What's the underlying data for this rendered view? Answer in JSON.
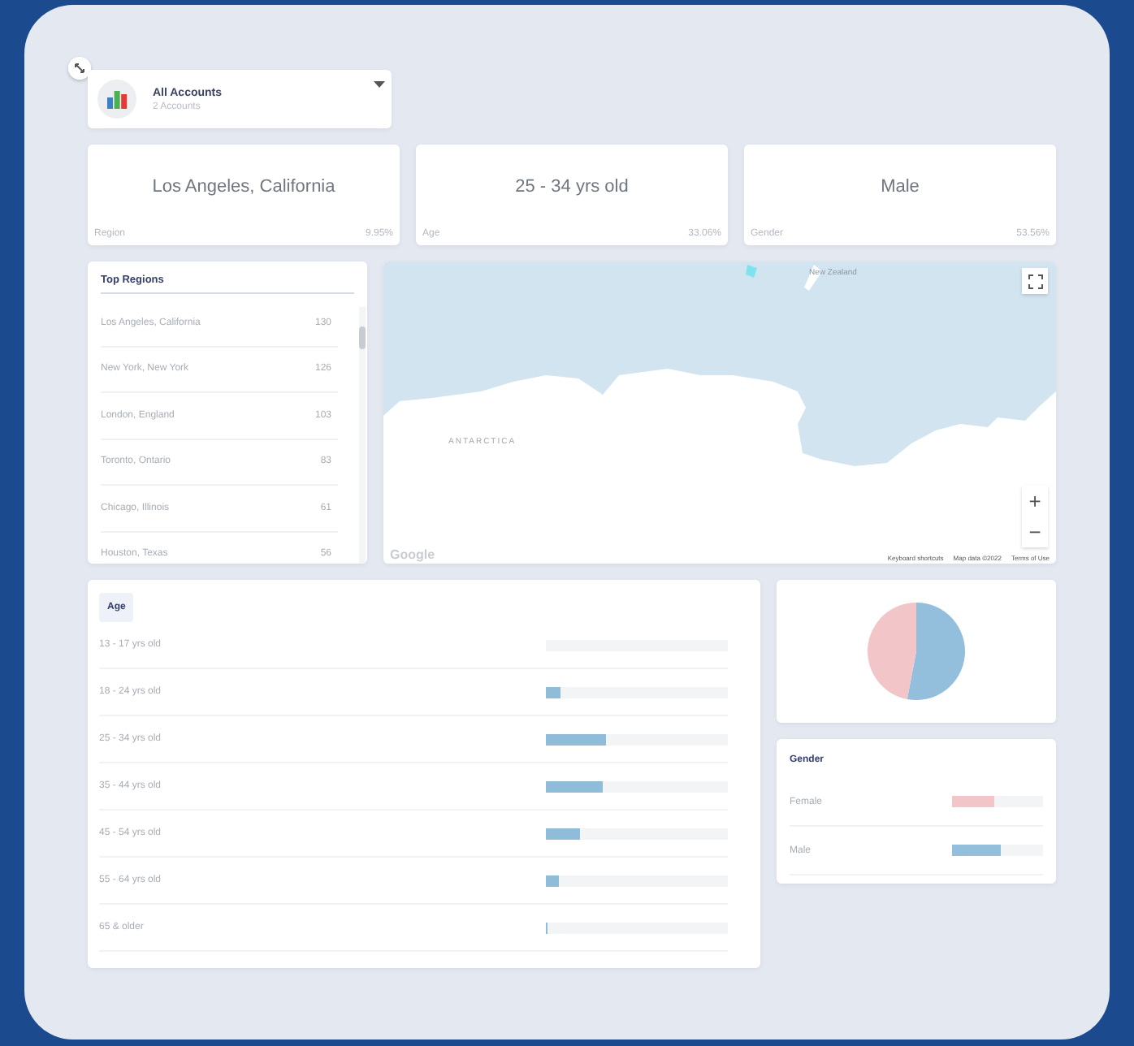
{
  "account": {
    "title": "All Accounts",
    "subtitle": "2 Accounts"
  },
  "stats": [
    {
      "value": "Los Angeles, California",
      "label": "Region",
      "percent": "9.95%"
    },
    {
      "value": "25 - 34 yrs old",
      "label": "Age",
      "percent": "33.06%"
    },
    {
      "value": "Male",
      "label": "Gender",
      "percent": "53.56%"
    }
  ],
  "top_regions": {
    "title": "Top Regions",
    "rows": [
      {
        "name": "Los Angeles, California",
        "count": "130"
      },
      {
        "name": "New York, New York",
        "count": "126"
      },
      {
        "name": "London, England",
        "count": "103"
      },
      {
        "name": "Toronto, Ontario",
        "count": "83"
      },
      {
        "name": "Chicago, Illinois",
        "count": "61"
      },
      {
        "name": "Houston, Texas",
        "count": "56"
      }
    ]
  },
  "map": {
    "place_labels": [
      "New Zealand",
      "ANTARCTICA"
    ],
    "logo": "Google",
    "attribution": [
      "Keyboard shortcuts",
      "Map data ©2022",
      "Terms of Use"
    ],
    "zoom_in": "+",
    "zoom_out": "−"
  },
  "age": {
    "title": "Age",
    "rows": [
      {
        "label": "13 - 17 yrs old",
        "level": 0
      },
      {
        "label": "18 - 24 yrs old",
        "level": 0.08
      },
      {
        "label": "25 - 34 yrs old",
        "level": 0.33
      },
      {
        "label": "35 - 44 yrs old",
        "level": 0.31
      },
      {
        "label": "45 - 54 yrs old",
        "level": 0.19
      },
      {
        "label": "55 - 64 yrs old",
        "level": 0.07
      },
      {
        "label": "65 & older",
        "level": 0.01
      }
    ]
  },
  "gender": {
    "title": "Gender",
    "rows": [
      {
        "label": "Female",
        "level": 0.47,
        "color": "#f2c6c9"
      },
      {
        "label": "Male",
        "level": 0.53,
        "color": "#93bfdc"
      }
    ]
  }
}
